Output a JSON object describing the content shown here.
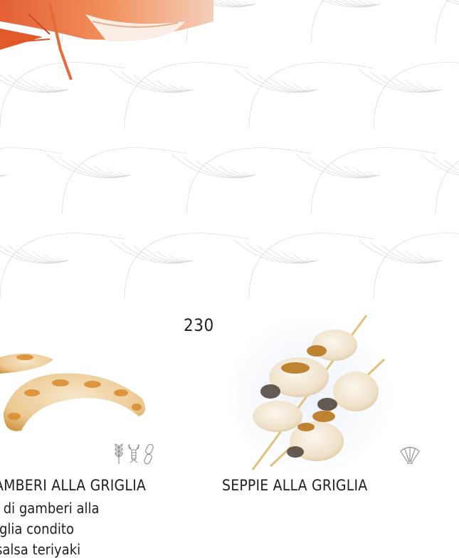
{
  "page_number": "230",
  "products": [
    {
      "title": "AMBERI ALLA GRIGLIA",
      "description_lines": [
        "i di gamberi alla",
        "iglia condito",
        "salsa teriyaki"
      ],
      "allergen_icons": [
        "wheat-icon",
        "crustacean-icon",
        "chain-icon"
      ]
    },
    {
      "title": "SEPPIE ALLA GRIGLIA",
      "allergen_icons": [
        "mollusc-icon"
      ]
    }
  ],
  "colors": {
    "pattern_line": "#c9c9c9",
    "text": "#1f1f1f",
    "icon": "#8c8c8c"
  }
}
